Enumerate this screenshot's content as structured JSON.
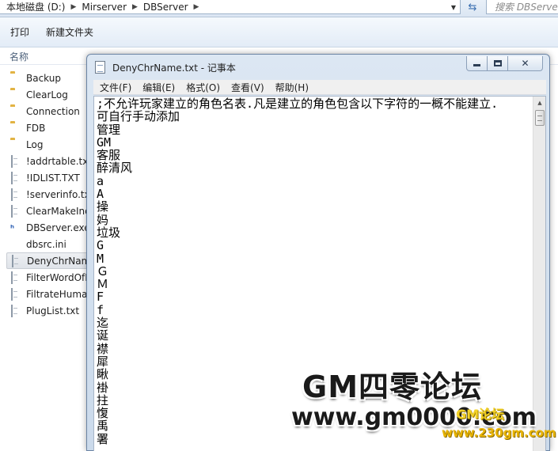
{
  "explorer": {
    "breadcrumbs": [
      "本地磁盘 (D:)",
      "Mirserver",
      "DBServer"
    ],
    "search_placeholder": "搜索 DBServer",
    "toolbar": {
      "print_label": "打印",
      "new_folder_label": "新建文件夹"
    },
    "column_name": "名称",
    "files": [
      {
        "name": "Backup",
        "icon": "folder-icon",
        "selected": false
      },
      {
        "name": "ClearLog",
        "icon": "folder-icon",
        "selected": false
      },
      {
        "name": "Connection",
        "icon": "folder-icon",
        "selected": false
      },
      {
        "name": "FDB",
        "icon": "folder-icon",
        "selected": false
      },
      {
        "name": "Log",
        "icon": "folder-icon",
        "selected": false
      },
      {
        "name": "!addrtable.txt",
        "icon": "text-file-icon",
        "selected": false
      },
      {
        "name": "!IDLIST.TXT",
        "icon": "text-file-icon",
        "selected": false
      },
      {
        "name": "!serverinfo.txt",
        "icon": "text-file-icon",
        "selected": false
      },
      {
        "name": "ClearMakeIndex",
        "icon": "text-file-icon",
        "selected": false
      },
      {
        "name": "DBServer.exe",
        "icon": "exe-file-icon",
        "selected": false
      },
      {
        "name": "dbsrc.ini",
        "icon": "ini-file-icon",
        "selected": false
      },
      {
        "name": "DenyChrName",
        "icon": "text-file-icon",
        "selected": true
      },
      {
        "name": "FilterWordOfL",
        "icon": "text-file-icon",
        "selected": false
      },
      {
        "name": "FiltrateHuman",
        "icon": "text-file-icon",
        "selected": false
      },
      {
        "name": "PlugList.txt",
        "icon": "text-file-icon",
        "selected": false
      }
    ]
  },
  "notepad": {
    "title": "DenyChrName.txt - 记事本",
    "menu": {
      "file": "文件(F)",
      "edit": "编辑(E)",
      "format": "格式(O)",
      "view": "查看(V)",
      "help": "帮助(H)"
    },
    "lines": [
      ";不允许玩家建立的角色名表.凡是建立的角色包含以下字符的一概不能建立.",
      "可自行手动添加",
      "管理",
      "GM",
      "客服",
      "醉清风",
      "a",
      "A",
      "操",
      "妈",
      "垃圾",
      "G",
      "M",
      "Ｇ",
      "Ｍ",
      "F",
      "f",
      "迄",
      "诞",
      "襟",
      "犀",
      "瞅",
      "褂",
      "拄",
      "愎",
      "禹",
      "署"
    ]
  },
  "watermark": {
    "forum_name": "GM四零论坛",
    "url": "www.gm0000.com",
    "logo_top": "GM论坛",
    "logo_bottom": "www.230gm.com"
  }
}
